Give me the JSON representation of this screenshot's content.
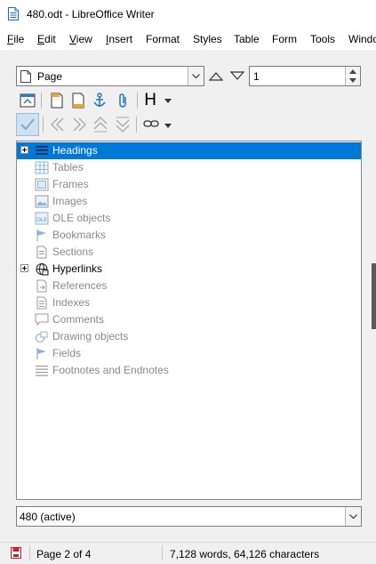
{
  "window": {
    "title": "480.odt - LibreOffice Writer"
  },
  "menubar": {
    "items": [
      {
        "label": "File",
        "u": "F",
        "rest": "ile"
      },
      {
        "label": "Edit",
        "u": "E",
        "rest": "dit"
      },
      {
        "label": "View",
        "u": "V",
        "rest": "iew"
      },
      {
        "label": "Insert",
        "u": "I",
        "rest": "nsert"
      },
      {
        "label": "Format",
        "u": "F",
        "rest": "ormat",
        "pre": ""
      },
      {
        "label": "Styles",
        "u": "S",
        "rest": "tyles",
        "pre": ""
      },
      {
        "label": "Table",
        "u": "T",
        "rest": "able",
        "pre": ""
      },
      {
        "label": "Form",
        "u": "F",
        "rest": "orm",
        "pre": ""
      },
      {
        "label": "Tools",
        "u": "T",
        "rest": "ools",
        "pre": ""
      },
      {
        "label": "Windo",
        "u": "W",
        "rest": "indo",
        "pre": ""
      }
    ]
  },
  "navigator": {
    "category": "Page",
    "page_number": "1",
    "heading_level_icon": "H",
    "tree": [
      {
        "label": "Headings",
        "icon": "headings-icon",
        "state": "selected",
        "expander": true
      },
      {
        "label": "Tables",
        "icon": "table-icon",
        "state": "disabled",
        "expander": false
      },
      {
        "label": "Frames",
        "icon": "frame-icon",
        "state": "disabled",
        "expander": false
      },
      {
        "label": "Images",
        "icon": "image-icon",
        "state": "disabled",
        "expander": false
      },
      {
        "label": "OLE objects",
        "icon": "ole-icon",
        "state": "disabled",
        "expander": false
      },
      {
        "label": "Bookmarks",
        "icon": "bookmark-icon",
        "state": "disabled",
        "expander": false
      },
      {
        "label": "Sections",
        "icon": "section-icon",
        "state": "disabled",
        "expander": false
      },
      {
        "label": "Hyperlinks",
        "icon": "hyperlink-icon",
        "state": "normal",
        "expander": true
      },
      {
        "label": "References",
        "icon": "reference-icon",
        "state": "disabled",
        "expander": false
      },
      {
        "label": "Indexes",
        "icon": "index-icon",
        "state": "disabled",
        "expander": false
      },
      {
        "label": "Comments",
        "icon": "comment-icon",
        "state": "disabled",
        "expander": false
      },
      {
        "label": "Drawing objects",
        "icon": "drawing-icon",
        "state": "disabled",
        "expander": false
      },
      {
        "label": "Fields",
        "icon": "field-icon",
        "state": "disabled",
        "expander": false
      },
      {
        "label": "Footnotes and Endnotes",
        "icon": "footnote-icon",
        "state": "disabled",
        "expander": false
      }
    ],
    "document": "480 (active)"
  },
  "statusbar": {
    "page": "Page 2 of 4",
    "words": "7,128 words, 64,126 characters"
  },
  "colors": {
    "selection": "#0078d7",
    "disabled_text": "#8a8a8a",
    "panel_bg": "#f0f0f0"
  }
}
